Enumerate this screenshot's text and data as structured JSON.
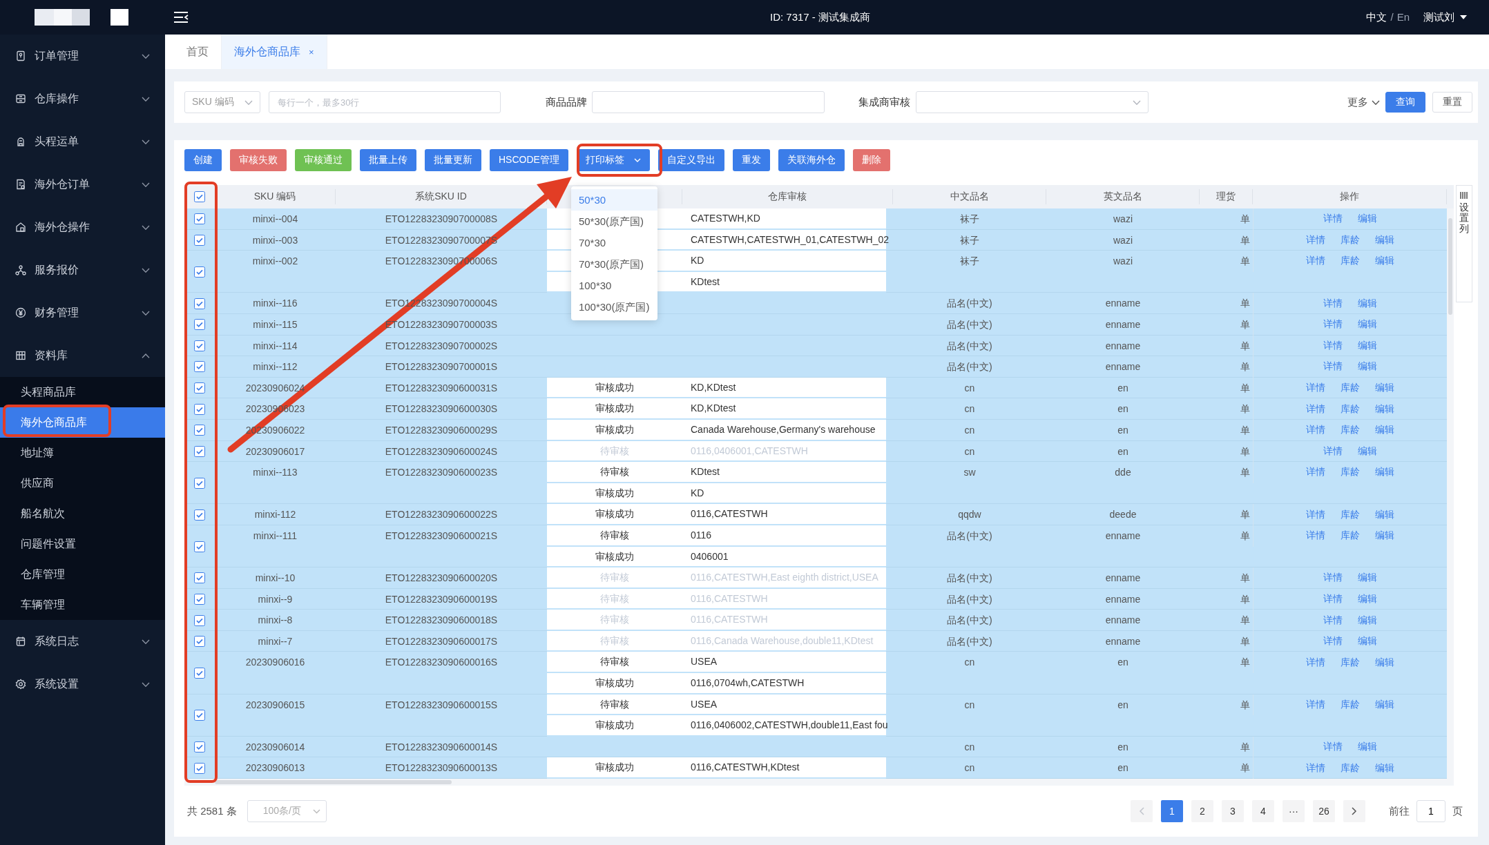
{
  "topbar": {
    "title": "ID: 7317 - 测试集成商",
    "languages": [
      {
        "label": "中文",
        "selected": true
      },
      {
        "label": "En",
        "selected": false
      }
    ],
    "language_separator": "/",
    "user": "测试刘"
  },
  "sidebar": {
    "items": [
      {
        "label": "订单管理",
        "expanded": false
      },
      {
        "label": "仓库操作",
        "expanded": false
      },
      {
        "label": "头程运单",
        "expanded": false
      },
      {
        "label": "海外仓订单",
        "expanded": false
      },
      {
        "label": "海外仓操作",
        "expanded": false
      },
      {
        "label": "服务报价",
        "expanded": false
      },
      {
        "label": "财务管理",
        "expanded": false
      },
      {
        "label": "资料库",
        "expanded": true,
        "children": [
          {
            "label": "头程商品库",
            "selected": false
          },
          {
            "label": "海外仓商品库",
            "selected": true
          },
          {
            "label": "地址簿",
            "selected": false
          },
          {
            "label": "供应商",
            "selected": false
          },
          {
            "label": "船名航次",
            "selected": false
          },
          {
            "label": "问题件设置",
            "selected": false
          },
          {
            "label": "仓库管理",
            "selected": false
          },
          {
            "label": "车辆管理",
            "selected": false
          }
        ]
      },
      {
        "label": "系统日志",
        "expanded": false
      },
      {
        "label": "系统设置",
        "expanded": false
      }
    ]
  },
  "tabs": [
    {
      "label": "首页",
      "selected": false
    },
    {
      "label": "海外仓商品库",
      "selected": true,
      "close": "×"
    }
  ],
  "filters": {
    "sku_type": "SKU 编码",
    "sku_placeholder": "每行一个，最多30行",
    "brand_label": "商品品牌",
    "review_label": "集成商审核",
    "more": "更多",
    "search": "查询",
    "reset": "重置"
  },
  "toolbar": [
    {
      "label": "创建",
      "kind": "primary"
    },
    {
      "label": "审核失败",
      "kind": "danger"
    },
    {
      "label": "审核通过",
      "kind": "success"
    },
    {
      "label": "批量上传",
      "kind": "primary"
    },
    {
      "label": "批量更新",
      "kind": "primary"
    },
    {
      "label": "HSCODE管理",
      "kind": "primary"
    },
    {
      "label": "打印标签",
      "kind": "primary",
      "dropdown": true
    },
    {
      "label": "自定义导出",
      "kind": "primary"
    },
    {
      "label": "重发",
      "kind": "primary"
    },
    {
      "label": "关联海外仓",
      "kind": "primary"
    },
    {
      "label": "删除",
      "kind": "danger"
    }
  ],
  "print_menu": {
    "options": [
      {
        "label": "50*30",
        "selected": true
      },
      {
        "label": "50*30(原产国)",
        "selected": false
      },
      {
        "label": "70*30",
        "selected": false
      },
      {
        "label": "70*30(原产国)",
        "selected": false
      },
      {
        "label": "100*30",
        "selected": false
      },
      {
        "label": "100*30(原产国)",
        "selected": false
      }
    ]
  },
  "table": {
    "header_checked": true,
    "settings_label": "设置列",
    "columns": [
      {
        "label": "SKU 编码"
      },
      {
        "label": "系统SKU ID"
      },
      {},
      {
        "label": "仓库审核"
      },
      {
        "label": "中文品名"
      },
      {
        "label": "英文品名"
      },
      {
        "label": "理货"
      },
      {
        "label": "操作"
      }
    ],
    "rows": [
      {
        "checked": true,
        "sku": "minxi--004",
        "system_id": "ETO1228323090700008S",
        "audits": [
          {
            "warehouses": "CATESTWH,KD",
            "disabled": false
          }
        ],
        "name_cn": "袜子",
        "name_en": "wazi",
        "unit": "单",
        "actions": [
          "详情",
          "编辑"
        ]
      },
      {
        "checked": true,
        "sku": "minxi--003",
        "system_id": "ETO1228323090700007S",
        "audits": [
          {
            "warehouses": "CATESTWH,CATESTWH_01,CATESTWH_02",
            "disabled": false
          }
        ],
        "name_cn": "袜子",
        "name_en": "wazi",
        "unit": "单",
        "actions": [
          "详情",
          "库龄",
          "编辑"
        ]
      },
      {
        "checked": true,
        "sku": "minxi--002",
        "system_id": "ETO1228323090700006S",
        "audits": [
          {
            "warehouses": "KD",
            "disabled": false
          },
          {
            "warehouses": "KDtest",
            "disabled": false
          }
        ],
        "name_cn": "袜子",
        "name_en": "wazi",
        "unit": "单",
        "actions": [
          "详情",
          "库龄",
          "编辑"
        ]
      },
      {
        "checked": true,
        "sku": "minxi--116",
        "system_id": "ETO1228323090700004S",
        "name_cn": "品名(中文)",
        "name_en": "enname",
        "unit": "单",
        "actions": [
          "详情",
          "编辑"
        ]
      },
      {
        "checked": true,
        "sku": "minxi--115",
        "system_id": "ETO1228323090700003S",
        "name_cn": "品名(中文)",
        "name_en": "enname",
        "unit": "单",
        "actions": [
          "详情",
          "编辑"
        ]
      },
      {
        "checked": true,
        "sku": "minxi--114",
        "system_id": "ETO1228323090700002S",
        "name_cn": "品名(中文)",
        "name_en": "enname",
        "unit": "单",
        "actions": [
          "详情",
          "编辑"
        ]
      },
      {
        "checked": true,
        "sku": "minxi--112",
        "system_id": "ETO1228323090700001S",
        "name_cn": "品名(中文)",
        "name_en": "enname",
        "unit": "单",
        "actions": [
          "详情",
          "编辑"
        ]
      },
      {
        "checked": true,
        "sku": "20230906024",
        "system_id": "ETO1228323090600031S",
        "audits": [
          {
            "status": "审核成功",
            "warehouses": "KD,KDtest",
            "disabled": false
          }
        ],
        "name_cn": "cn",
        "name_en": "en",
        "unit": "单",
        "actions": [
          "详情",
          "库龄",
          "编辑"
        ]
      },
      {
        "checked": true,
        "sku": "20230906023",
        "system_id": "ETO1228323090600030S",
        "audits": [
          {
            "status": "审核成功",
            "warehouses": "KD,KDtest",
            "disabled": false
          }
        ],
        "name_cn": "cn",
        "name_en": "en",
        "unit": "单",
        "actions": [
          "详情",
          "库龄",
          "编辑"
        ]
      },
      {
        "checked": true,
        "sku": "20230906022",
        "system_id": "ETO1228323090600029S",
        "audits": [
          {
            "status": "审核成功",
            "warehouses": "Canada Warehouse,Germany's warehouse",
            "disabled": false
          }
        ],
        "name_cn": "cn",
        "name_en": "en",
        "unit": "单",
        "actions": [
          "详情",
          "库龄",
          "编辑"
        ]
      },
      {
        "checked": true,
        "sku": "20230906017",
        "system_id": "ETO1228323090600024S",
        "audits": [
          {
            "status": "待审核",
            "warehouses": "0116,0406001,CATESTWH",
            "disabled": true
          }
        ],
        "name_cn": "cn",
        "name_en": "en",
        "unit": "单",
        "actions": [
          "详情",
          "编辑"
        ]
      },
      {
        "checked": true,
        "sku": "minxi--113",
        "system_id": "ETO1228323090600023S",
        "audits": [
          {
            "status": "待审核",
            "warehouses": "KDtest",
            "disabled": false
          },
          {
            "status": "审核成功",
            "warehouses": "KD",
            "disabled": false
          }
        ],
        "name_cn": "sw",
        "name_en": "dde",
        "unit": "单",
        "actions": [
          "详情",
          "库龄",
          "编辑"
        ]
      },
      {
        "checked": true,
        "sku": "minxi-112",
        "system_id": "ETO1228323090600022S",
        "audits": [
          {
            "status": "审核成功",
            "warehouses": "0116,CATESTWH",
            "disabled": false
          }
        ],
        "name_cn": "qqdw",
        "name_en": "deede",
        "unit": "单",
        "actions": [
          "详情",
          "库龄",
          "编辑"
        ]
      },
      {
        "checked": true,
        "sku": "minxi--111",
        "system_id": "ETO1228323090600021S",
        "audits": [
          {
            "status": "待审核",
            "warehouses": "0116",
            "disabled": false
          },
          {
            "status": "审核成功",
            "warehouses": "0406001",
            "disabled": false
          }
        ],
        "name_cn": "品名(中文)",
        "name_en": "enname",
        "unit": "单",
        "actions": [
          "详情",
          "库龄",
          "编辑"
        ]
      },
      {
        "checked": true,
        "sku": "minxi--10",
        "system_id": "ETO1228323090600020S",
        "audits": [
          {
            "status": "待审核",
            "warehouses": "0116,CATESTWH,East eighth district,USEA",
            "disabled": true
          }
        ],
        "name_cn": "品名(中文)",
        "name_en": "enname",
        "unit": "单",
        "actions": [
          "详情",
          "编辑"
        ]
      },
      {
        "checked": true,
        "sku": "minxi--9",
        "system_id": "ETO1228323090600019S",
        "audits": [
          {
            "status": "待审核",
            "warehouses": "0116,CATESTWH",
            "disabled": true
          }
        ],
        "name_cn": "品名(中文)",
        "name_en": "enname",
        "unit": "单",
        "actions": [
          "详情",
          "编辑"
        ]
      },
      {
        "checked": true,
        "sku": "minxi--8",
        "system_id": "ETO1228323090600018S",
        "audits": [
          {
            "status": "待审核",
            "warehouses": "0116,CATESTWH",
            "disabled": true
          }
        ],
        "name_cn": "品名(中文)",
        "name_en": "enname",
        "unit": "单",
        "actions": [
          "详情",
          "编辑"
        ]
      },
      {
        "checked": true,
        "sku": "minxi--7",
        "system_id": "ETO1228323090600017S",
        "audits": [
          {
            "status": "待审核",
            "warehouses": "0116,Canada Warehouse,double11,KDtest",
            "disabled": true
          }
        ],
        "name_cn": "品名(中文)",
        "name_en": "enname",
        "unit": "单",
        "actions": [
          "详情",
          "编辑"
        ]
      },
      {
        "checked": true,
        "sku": "20230906016",
        "system_id": "ETO1228323090600016S",
        "audits": [
          {
            "status": "待审核",
            "warehouses": "USEA",
            "disabled": false
          },
          {
            "status": "审核成功",
            "warehouses": "0116,0704wh,CATESTWH",
            "disabled": false
          }
        ],
        "name_cn": "cn",
        "name_en": "en",
        "unit": "单",
        "actions": [
          "详情",
          "库龄",
          "编辑"
        ]
      },
      {
        "checked": true,
        "sku": "20230906015",
        "system_id": "ETO1228323090600015S",
        "audits": [
          {
            "status": "待审核",
            "warehouses": "USEA",
            "disabled": false
          },
          {
            "status": "审核成功",
            "warehouses": "0116,0406002,CATESTWH,double11,East fou",
            "disabled": false
          }
        ],
        "name_cn": "cn",
        "name_en": "en",
        "unit": "单",
        "actions": [
          "详情",
          "库龄",
          "编辑"
        ]
      },
      {
        "checked": true,
        "sku": "20230906014",
        "system_id": "ETO1228323090600014S",
        "name_cn": "cn",
        "name_en": "en",
        "unit": "单",
        "actions": [
          "详情",
          "编辑"
        ]
      },
      {
        "checked": true,
        "sku": "20230906013",
        "system_id": "ETO1228323090600013S",
        "audits": [
          {
            "status": "审核成功",
            "warehouses": "0116,CATESTWH,KDtest",
            "disabled": false
          }
        ],
        "name_cn": "cn",
        "name_en": "en",
        "unit": "单",
        "actions": [
          "详情",
          "库龄",
          "编辑"
        ]
      }
    ]
  },
  "pagination": {
    "total": "共 2581 条",
    "page_size": "100条/页",
    "pages": [
      {
        "label": "1",
        "selected": true
      },
      {
        "label": "2",
        "selected": false
      },
      {
        "label": "3",
        "selected": false
      },
      {
        "label": "4",
        "selected": false
      },
      {
        "label": "···",
        "selected": false
      },
      {
        "label": "26",
        "selected": false
      }
    ],
    "goto_label": "前往",
    "goto_value": "1",
    "page_suffix": "页"
  }
}
